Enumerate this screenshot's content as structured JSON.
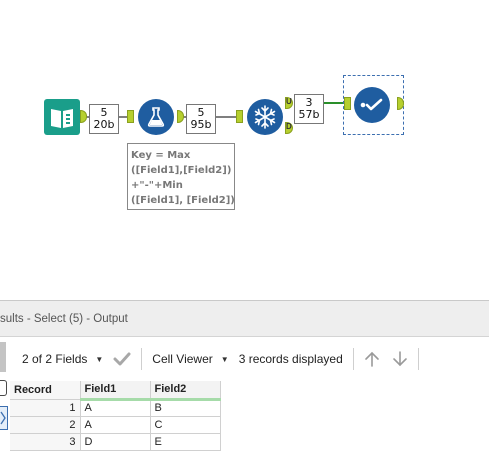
{
  "workflow": {
    "tools": [
      {
        "id": "input",
        "name": "input-data-tool",
        "icon": "book-icon",
        "color": "#1a9e8a"
      },
      {
        "id": "formula",
        "name": "formula-tool",
        "icon": "flask-icon",
        "color": "#1f5da0"
      },
      {
        "id": "summarize",
        "name": "summarize-tool",
        "icon": "snowflake-icon",
        "color": "#1f5da0"
      },
      {
        "id": "select",
        "name": "select-tool",
        "icon": "check-icon",
        "color": "#1f5da0"
      }
    ],
    "badges": [
      {
        "records": "5",
        "size": "20b"
      },
      {
        "records": "5",
        "size": "95b"
      },
      {
        "records": "3",
        "size": "57b"
      }
    ],
    "anchor_labels": {
      "unique": "U",
      "duplicate": "D"
    },
    "annotation": "Key = Max\n([Field1],[Field2])\n+\"-\"+Min\n([Field1], [Field2])"
  },
  "results": {
    "title": "sults - Select (5) - Output",
    "fields_selector": "2 of 2 Fields",
    "cell_viewer": "Cell Viewer",
    "records_displayed": "3 records displayed",
    "columns": [
      "Record",
      "Field1",
      "Field2"
    ],
    "rows": [
      {
        "record": "1",
        "field1": "A",
        "field2": "B"
      },
      {
        "record": "2",
        "field1": "A",
        "field2": "C"
      },
      {
        "record": "3",
        "field1": "D",
        "field2": "E"
      }
    ]
  }
}
